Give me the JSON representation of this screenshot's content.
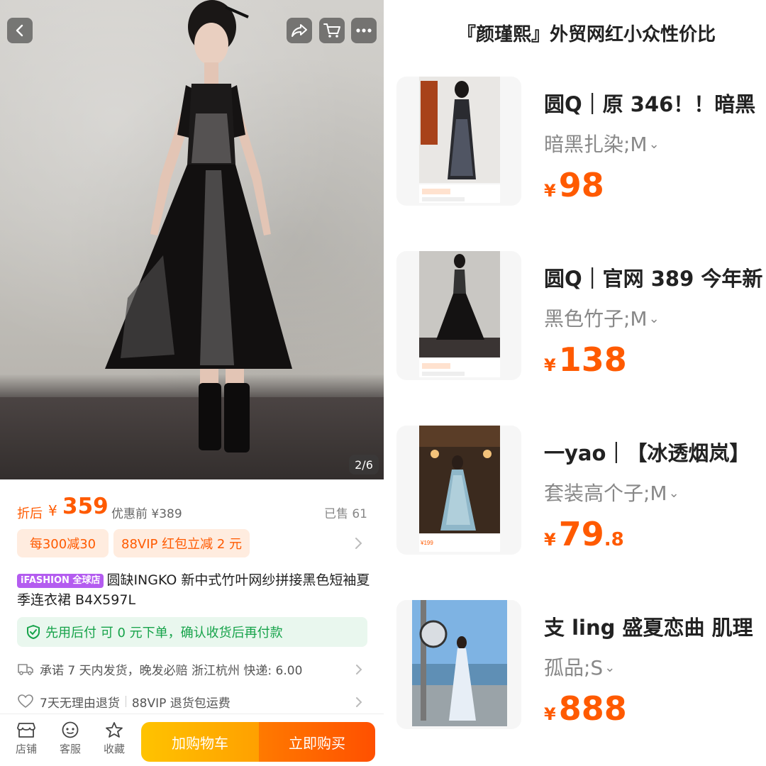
{
  "left_panel": {
    "image_counter": "2/6",
    "price": {
      "tag": "折后",
      "currency": "¥",
      "value": "359",
      "before_label": "优惠前 ¥389",
      "sold": "已售 61"
    },
    "promos": [
      "每300减30",
      "88VIP 红包立减 2 元"
    ],
    "store_badge": "iFASHION 全球店",
    "product_title": "圆缺INGKO 新中式竹叶网纱拼接黑色短袖夏季连衣裙 B4X597L",
    "pay_later": "先用后付 可 0 元下单，确认收货后再付款",
    "shipping": "承诺 7 天内发货，晚发必赔 浙江杭州 快递: 6.00",
    "returns_left": "7天无理由退货",
    "returns_right": "88VIP 退货包运费",
    "bottom_bar": {
      "shop": "店铺",
      "service": "客服",
      "favorite": "收藏",
      "add_to_cart": "加购物车",
      "buy_now": "立即购买"
    },
    "icons": [
      "back-icon",
      "share-icon",
      "cart-icon",
      "more-icon",
      "shield-check-icon",
      "truck-icon",
      "heart-icon",
      "chevron-right-icon",
      "store-icon",
      "service-icon",
      "star-icon"
    ]
  },
  "right_panel": {
    "list_title": "『颜瑾熙』外贸网红小众性价比",
    "items": [
      {
        "title": "圆Q｜原 346！！暗黑",
        "sku": "暗黑扎染;M",
        "currency": "¥",
        "price_int": "98",
        "price_dec": "",
        "thumb_price": "¥301"
      },
      {
        "title": "圆Q｜官网 389 今年新",
        "sku": "黑色竹子;M",
        "currency": "¥",
        "price_int": "138",
        "price_dec": "",
        "thumb_price": "¥344"
      },
      {
        "title": "一yao｜【冰透烟岚】",
        "sku": "套装高个子;M",
        "currency": "¥",
        "price_int": "79",
        "price_dec": ".8",
        "thumb_price": "¥199"
      },
      {
        "title": "支 ling  盛夏恋曲  肌理",
        "sku": "孤品;S",
        "currency": "¥",
        "price_int": "888",
        "price_dec": "",
        "thumb_price": ""
      }
    ]
  },
  "colors": {
    "accent": "#ff5a00",
    "promo_bg": "#ffecdf",
    "paylater_bg": "#e9f7ee",
    "paylater_text": "#16a34a",
    "add_to_cart": "#ffb000",
    "buy_now": "#ff6a00",
    "badge": "#b45cf0"
  }
}
